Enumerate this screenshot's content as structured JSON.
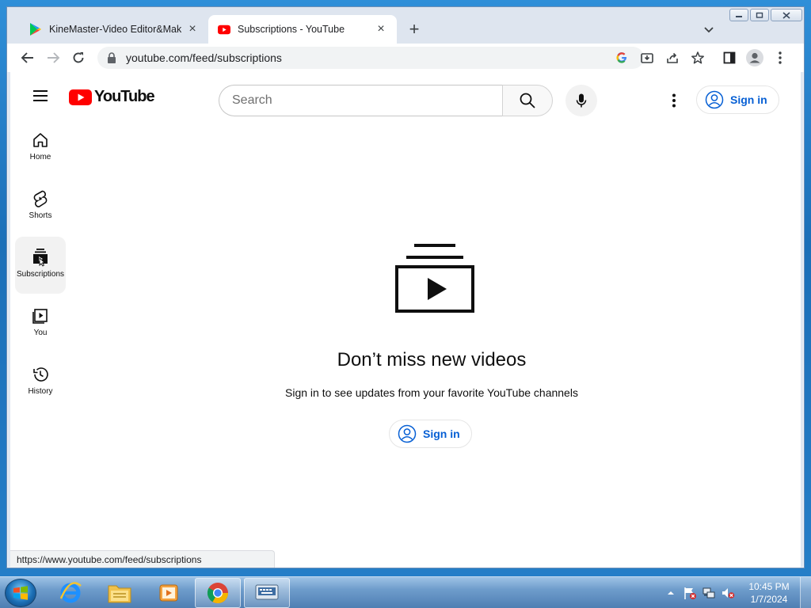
{
  "browser": {
    "tabs": [
      {
        "title": "KineMaster-Video Editor&Maker",
        "active": false,
        "favicon": "google-play-icon"
      },
      {
        "title": "Subscriptions - YouTube",
        "active": true,
        "favicon": "youtube-icon"
      }
    ],
    "address": "youtube.com/feed/subscriptions",
    "status_url": "https://www.youtube.com/feed/subscriptions"
  },
  "youtube": {
    "logo_text": "YouTube",
    "search_placeholder": "Search",
    "sign_in_label": "Sign in",
    "sidebar": [
      {
        "label": "Home",
        "icon": "home-icon",
        "active": false
      },
      {
        "label": "Shorts",
        "icon": "shorts-icon",
        "active": false
      },
      {
        "label": "Subscriptions",
        "icon": "subscriptions-icon",
        "active": true
      },
      {
        "label": "You",
        "icon": "you-icon",
        "active": false
      },
      {
        "label": "History",
        "icon": "history-icon",
        "active": false
      }
    ],
    "empty_state": {
      "title": "Don’t miss new videos",
      "subtitle": "Sign in to see updates from your favorite YouTube channels",
      "button": "Sign in"
    }
  },
  "taskbar": {
    "time": "10:45 PM",
    "date": "1/7/2024"
  },
  "colors": {
    "youtube_red": "#ff0000",
    "link_blue": "#065fd4"
  }
}
